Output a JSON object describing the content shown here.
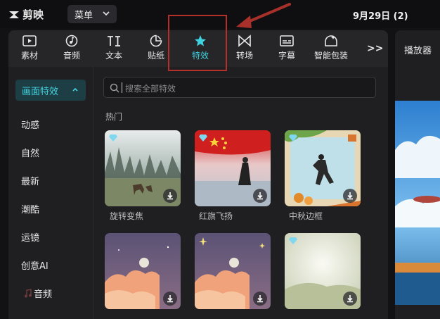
{
  "app": {
    "logo_text": "剪映"
  },
  "topbar": {
    "menu_label": "菜单",
    "date_text": "9月29日 (2)"
  },
  "tabs": [
    {
      "label": "素材",
      "icon": "media-play-icon"
    },
    {
      "label": "音频",
      "icon": "music-note-icon"
    },
    {
      "label": "文本",
      "icon": "text-ti-icon"
    },
    {
      "label": "贴纸",
      "icon": "sticker-icon"
    },
    {
      "label": "特效",
      "icon": "effects-star-icon",
      "active": true
    },
    {
      "label": "转场",
      "icon": "transition-bowtie-icon"
    },
    {
      "label": "字幕",
      "icon": "subtitle-icon"
    },
    {
      "label": "智能包装",
      "icon": "smart-pack-icon"
    }
  ],
  "tabs_more": ">>",
  "sidebar": {
    "active_label": "画面特效",
    "items": [
      "动感",
      "自然",
      "最新",
      "潮酷",
      "运镜",
      "创意AI",
      "音频"
    ]
  },
  "search": {
    "placeholder": "搜索全部特效"
  },
  "section_title": "热门",
  "cards": [
    {
      "label": "旋转变焦"
    },
    {
      "label": "红旗飞扬"
    },
    {
      "label": "中秋边框"
    },
    {
      "label": ""
    },
    {
      "label": ""
    },
    {
      "label": ""
    }
  ],
  "preview": {
    "title": "播放器"
  },
  "colors": {
    "accent": "#3fd2e0",
    "highlight_box": "#b5302b",
    "arrow": "#a8302a"
  }
}
